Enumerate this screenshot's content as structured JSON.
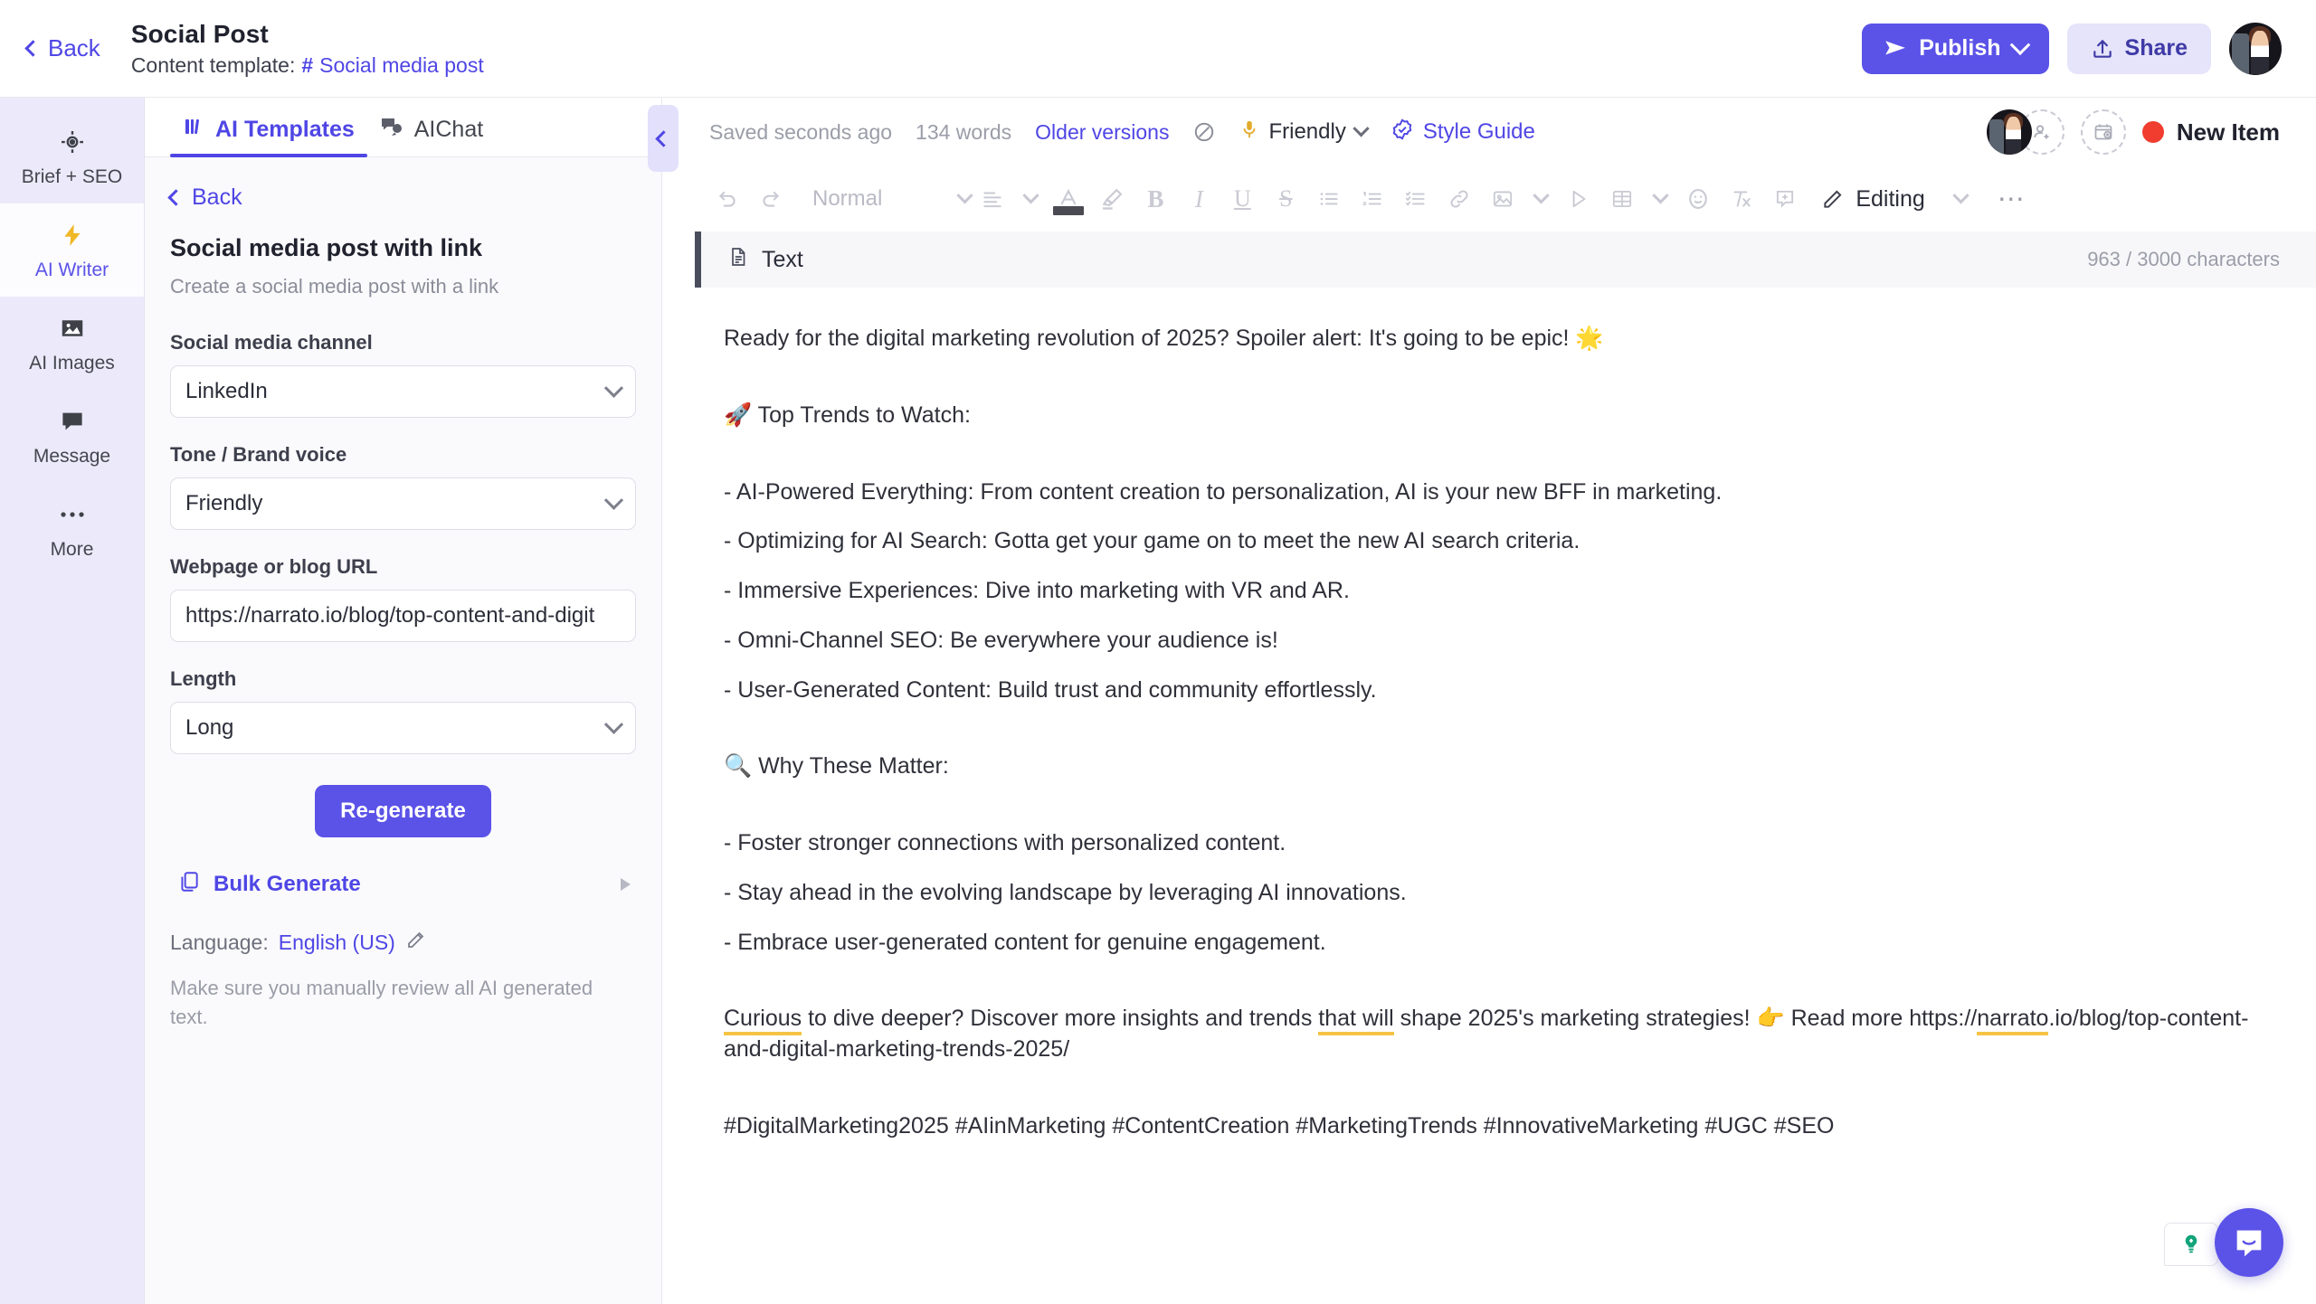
{
  "topbar": {
    "back_label": "Back",
    "doc_title": "Social Post",
    "template_prefix": "Content template:",
    "template_hash": "#",
    "template_name": "Social media post",
    "publish_label": "Publish",
    "share_label": "Share",
    "publish_icon": "send-icon",
    "share_icon": "upload-icon",
    "avatar_icon": "user-avatar"
  },
  "rail": {
    "items": [
      {
        "label": "Brief + SEO",
        "icon": "target-icon",
        "active": false
      },
      {
        "label": "AI Writer",
        "icon": "lightning-icon",
        "active": true
      },
      {
        "label": "AI Images",
        "icon": "image-icon",
        "active": false
      },
      {
        "label": "Message",
        "icon": "chat-bubble-icon",
        "active": false
      },
      {
        "label": "More",
        "icon": "ellipsis-icon",
        "active": false
      }
    ]
  },
  "panel": {
    "tabs": [
      {
        "label": "AI Templates",
        "icon": "templates-icon",
        "active": true
      },
      {
        "label": "AIChat",
        "icon": "chat-icon",
        "active": false
      }
    ],
    "back_label": "Back",
    "template_title": "Social media post with link",
    "template_desc": "Create a social media post with a link",
    "fields": [
      {
        "label": "Social media channel",
        "value": "LinkedIn",
        "type": "select"
      },
      {
        "label": "Tone / Brand voice",
        "value": "Friendly",
        "type": "select"
      },
      {
        "label": "Webpage or blog URL",
        "value": "https://narrato.io/blog/top-content-and-digit",
        "type": "text"
      },
      {
        "label": "Length",
        "value": "Long",
        "type": "select"
      }
    ],
    "regenerate_label": "Re-generate",
    "bulk_generate_label": "Bulk Generate",
    "bulk_generate_icon": "copy-icon",
    "language_prefix": "Language:",
    "language_value": "English (US)",
    "language_edit_icon": "pencil-edit-icon",
    "disclaimer": "Make sure you manually review all AI generated text.",
    "collapse_icon": "chevron-left-icon"
  },
  "editor_meta": {
    "saved_status": "Saved seconds ago",
    "word_count": "134 words",
    "older_versions": "Older versions",
    "preview_icon": "eye-off-icon",
    "tone_icon": "microphone-icon",
    "tone_value": "Friendly",
    "style_guide_icon": "badge-check-icon",
    "style_guide_label": "Style Guide",
    "add_member_icon": "add-user-icon",
    "add_task_icon": "add-calendar-icon",
    "status_label": "New Item",
    "status_color": "#f03d2f"
  },
  "toolbar": {
    "undo_icon": "undo-icon",
    "redo_icon": "redo-icon",
    "paragraph_style": "Normal",
    "align_icon": "align-left-icon",
    "font_color_icon": "font-color-icon",
    "highlight_icon": "highlighter-icon",
    "bold_icon": "bold-icon",
    "italic_icon": "italic-icon",
    "underline_icon": "underline-icon",
    "strikethrough_icon": "strikethrough-icon",
    "bullet_list_icon": "bullet-list-icon",
    "numbered_list_icon": "numbered-list-icon",
    "checklist_icon": "checklist-icon",
    "link_icon": "link-icon",
    "image_icon": "image-insert-icon",
    "video_icon": "video-play-icon",
    "table_icon": "table-icon",
    "emoji_icon": "emoji-icon",
    "clear_format_icon": "clear-formatting-icon",
    "comment_icon": "add-comment-icon",
    "mode_icon": "pencil-icon",
    "mode_label": "Editing",
    "more_icon": "ellipsis-icon"
  },
  "block": {
    "icon": "document-icon",
    "title": "Text",
    "char_count": "963 / 3000 characters"
  },
  "document": {
    "paragraphs": [
      {
        "text": "Ready for the digital marketing revolution of 2025? Spoiler alert: It's going to be epic! 🌟",
        "tight": false
      },
      {
        "text": "🚀 Top Trends to Watch:",
        "tight": false
      },
      {
        "text": "- AI-Powered Everything: From content creation to personalization, AI is your new BFF in marketing.",
        "tight": true
      },
      {
        "text": "- Optimizing for AI Search: Gotta get your game on to meet the new AI search criteria.",
        "tight": true
      },
      {
        "text": "- Immersive Experiences: Dive into marketing with VR and AR.",
        "tight": true
      },
      {
        "text": "- Omni-Channel SEO: Be everywhere your audience is!",
        "tight": true
      },
      {
        "text": "- User-Generated Content: Build trust and community effortlessly.",
        "tight": false
      },
      {
        "text": "🔍 Why These Matter:",
        "tight": false
      },
      {
        "text": "- Foster stronger connections with personalized content.",
        "tight": true
      },
      {
        "text": "- Stay ahead in the evolving landscape by leveraging AI innovations.",
        "tight": true
      },
      {
        "text": "- Embrace user-generated content for genuine engagement.",
        "tight": false
      }
    ],
    "cta_part1": "Curious",
    "cta_part2": " to dive deeper? Discover more insights and trends ",
    "cta_part3": "that will",
    "cta_part4": " shape 2025's marketing strategies! 👉 Read more ",
    "cta_url_pre": "https://",
    "cta_url_mid": "narrato",
    "cta_url_post": ".io/blog/top-content-and-digital-marketing-trends-2025/",
    "hashtags": "#DigitalMarketing2025 #AIinMarketing #ContentCreation #MarketingTrends #InnovativeMarketing #UGC #SEO",
    "grammar_underline_color": "#f5c445"
  },
  "floating": {
    "hint_icon": "lightbulb-icon",
    "chat_icon": "intercom-chat-icon",
    "chat_color": "#5b52e8"
  }
}
